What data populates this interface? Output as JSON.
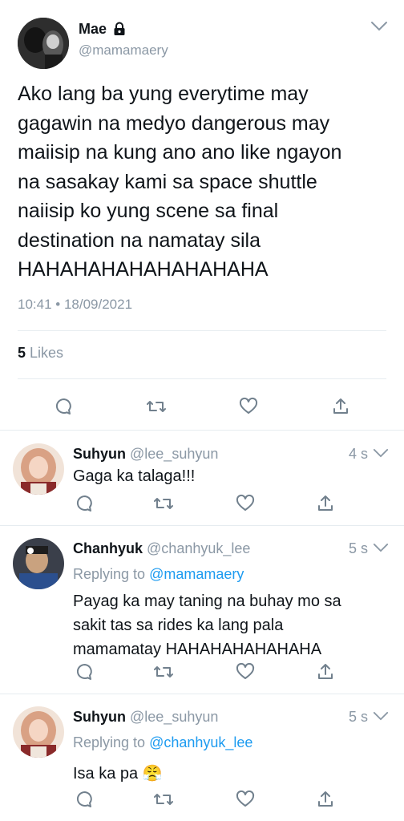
{
  "tweet": {
    "author_name": "Mae",
    "author_handle": "@mamamaery",
    "lines": [
      "Ako lang ba yung everytime may",
      "gagawin na medyo dangerous may",
      "maiisip na kung ano ano like ngayon",
      "na sasakay kami sa space shuttle",
      "naiisip ko yung scene sa final",
      "destination na namatay sila",
      "HAHAHAHAHAHAHAHAHA"
    ],
    "timestamp": "10:41 • 18/09/2021",
    "likes_count": "5",
    "likes_label": "Likes"
  },
  "replies": [
    {
      "name": "Suhyun",
      "handle": "@lee_suhyun",
      "age": "4 s",
      "replying_label": "",
      "replying_to": "",
      "text_lines": [
        "Gaga ka talaga!!!"
      ]
    },
    {
      "name": "Chanhyuk",
      "handle": "@chanhyuk_lee",
      "age": "5 s",
      "replying_label": "Replying to",
      "replying_to": "@mamamaery",
      "text_lines": [
        "Payag ka may taning na buhay mo sa",
        "sakit tas sa rides ka lang pala",
        "mamamatay HAHAHAHAHAHAHA"
      ]
    },
    {
      "name": "Suhyun",
      "handle": "@lee_suhyun",
      "age": "5 s",
      "replying_label": "Replying to",
      "replying_to": "@chanhyuk_lee",
      "text_lines": [
        "Isa ka pa 😤"
      ]
    }
  ],
  "icons": {
    "lock": "lock-icon",
    "chevron": "chevron-down-icon",
    "reply": "reply-icon",
    "retweet": "retweet-icon",
    "like": "heart-icon",
    "share": "share-icon"
  },
  "colors": {
    "text": "#0f1419",
    "muted": "#8b98a5",
    "link": "#1d9bf0",
    "divider": "#e6ecf0"
  }
}
